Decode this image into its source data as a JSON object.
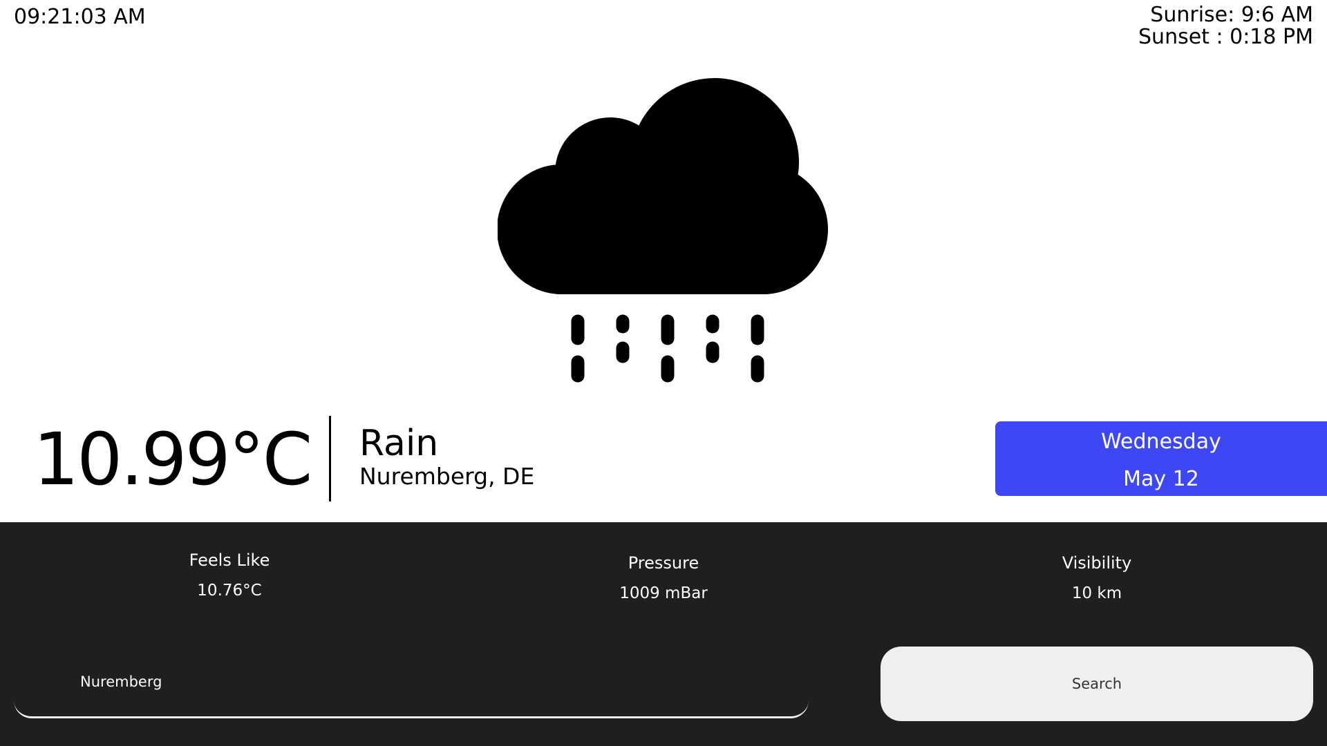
{
  "header": {
    "time": "09:21:03 AM",
    "sunrise": "Sunrise: 9:6 AM",
    "sunset": "Sunset : 0:18 PM"
  },
  "weather": {
    "icon": "cloud-rain-icon",
    "temperature": "10.99°C",
    "condition": "Rain",
    "location": "Nuremberg, DE"
  },
  "date": {
    "day": "Wednesday",
    "date": "May 12",
    "accent_color": "#3d47f5"
  },
  "details": {
    "feels_like_label": "Feels Like",
    "feels_like_value": "10.76°C",
    "pressure_label": "Pressure",
    "pressure_value": "1009 mBar",
    "visibility_label": "Visibility",
    "visibility_value": "10 km"
  },
  "search": {
    "input_value": "Nuremberg",
    "button_label": "Search"
  },
  "colors": {
    "panel_background": "#1f1f1f",
    "page_background": "#ffffff"
  }
}
